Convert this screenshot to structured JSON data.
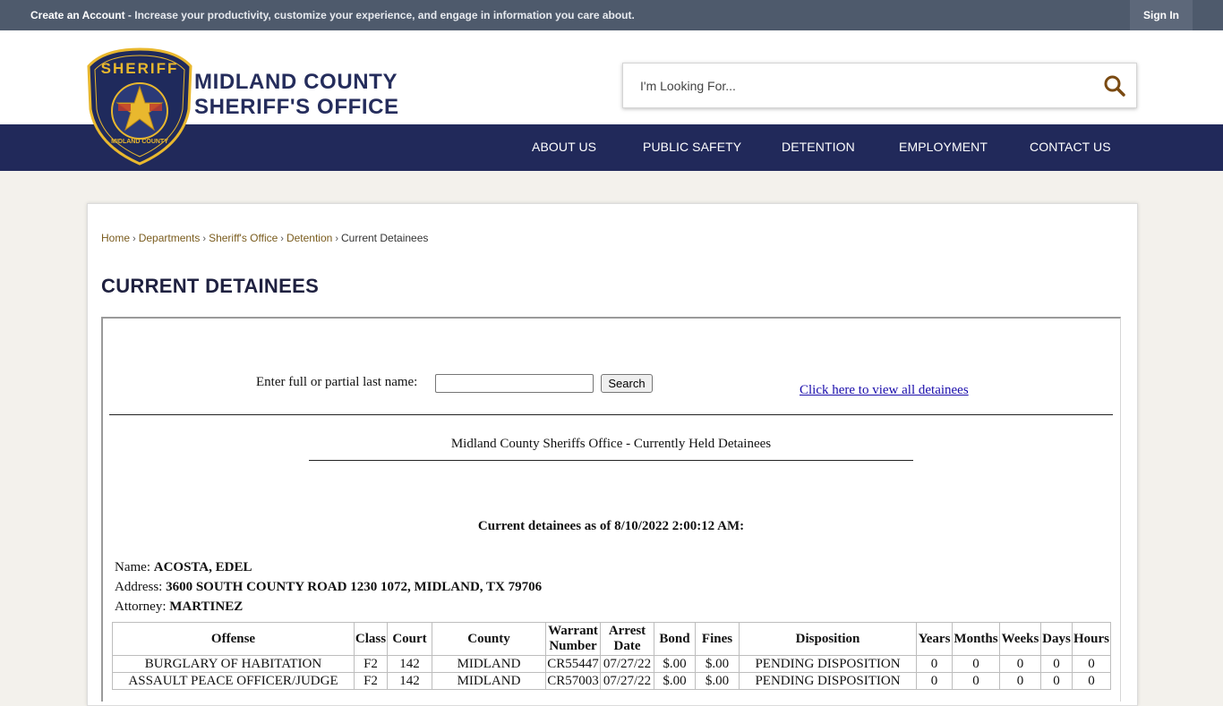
{
  "topbar": {
    "create_account": "Create an Account",
    "message": " - Increase your productivity, customize your experience, and engage in information you care about.",
    "sign_in": "Sign In"
  },
  "brand": {
    "line1": "MIDLAND COUNTY",
    "line2": "SHERIFF'S OFFICE",
    "badge_text": "SHERIFF",
    "badge_ring_text": "MIDLAND COUNTY"
  },
  "search": {
    "placeholder": "I'm Looking For..."
  },
  "nav": [
    "ABOUT US",
    "PUBLIC SAFETY",
    "DETENTION",
    "EMPLOYMENT",
    "CONTACT US"
  ],
  "breadcrumb": [
    "Home",
    "Departments",
    "Sheriff's Office",
    "Detention",
    "Current Detainees"
  ],
  "page_title": "CURRENT DETAINEES",
  "search_form": {
    "label": "Enter full or partial last name:",
    "value": "",
    "button": "Search",
    "view_all": "Click here to view all detainees"
  },
  "held_title": "Midland County Sheriffs Office - Currently Held Detainees",
  "as_of": "Current detainees as of 8/10/2022 2:00:12 AM:",
  "detainee": {
    "name_label": "Name:",
    "name": "ACOSTA, EDEL",
    "address_label": "Address:",
    "address": "3600 SOUTH COUNTY ROAD 1230 1072, MIDLAND, TX 79706",
    "attorney_label": "Attorney:",
    "attorney": "MARTINEZ"
  },
  "table": {
    "headers": [
      "Offense",
      "Class",
      "Court",
      "County",
      "Warrant Number",
      "Arrest Date",
      "Bond",
      "Fines",
      "Disposition",
      "Years",
      "Months",
      "Weeks",
      "Days",
      "Hours"
    ],
    "rows": [
      [
        "BURGLARY OF HABITATION",
        "F2",
        "142",
        "MIDLAND",
        "CR55447",
        "07/27/22",
        "$.00",
        "$.00",
        "PENDING DISPOSITION",
        "0",
        "0",
        "0",
        "0",
        "0"
      ],
      [
        "ASSAULT PEACE OFFICER/JUDGE",
        "F2",
        "142",
        "MIDLAND",
        "CR57003",
        "07/27/22",
        "$.00",
        "$.00",
        "PENDING DISPOSITION",
        "0",
        "0",
        "0",
        "0",
        "0"
      ]
    ]
  },
  "colors": {
    "topbar": "#4e5a6c",
    "nav": "#21295a",
    "brand_text": "#252d5c",
    "badge_gold": "#e9b82e",
    "badge_navy": "#1f2a5c",
    "search_icon": "#7a4a12"
  }
}
